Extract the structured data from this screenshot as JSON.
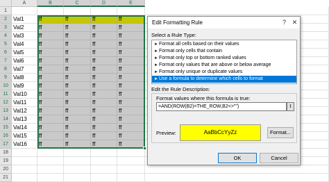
{
  "sheet": {
    "columns": [
      "A",
      "B",
      "C",
      "D",
      "E"
    ],
    "rows": [
      {
        "num": "1",
        "a": "",
        "vals": [
          "",
          "",
          "",
          ""
        ],
        "highlight": false
      },
      {
        "num": "2",
        "a": "Val1",
        "vals": [
          "ff",
          "ff",
          "ff",
          "ff"
        ],
        "highlight": true
      },
      {
        "num": "3",
        "a": "Val2",
        "vals": [
          "ff",
          "ff",
          "ff",
          "ff"
        ],
        "highlight": false
      },
      {
        "num": "4",
        "a": "Val3",
        "vals": [
          "ff",
          "ff",
          "ff",
          "ff"
        ],
        "highlight": false
      },
      {
        "num": "5",
        "a": "Val4",
        "vals": [
          "ff",
          "ff",
          "ff",
          "ff"
        ],
        "highlight": false
      },
      {
        "num": "6",
        "a": "Val5",
        "vals": [
          "ff",
          "ff",
          "ff",
          "ff"
        ],
        "highlight": false
      },
      {
        "num": "7",
        "a": "Val6",
        "vals": [
          "ff",
          "ff",
          "ff",
          "ff"
        ],
        "highlight": false
      },
      {
        "num": "8",
        "a": "Val7",
        "vals": [
          "ff",
          "ff",
          "ff",
          "ff"
        ],
        "highlight": false
      },
      {
        "num": "9",
        "a": "Val8",
        "vals": [
          "ff",
          "ff",
          "ff",
          "ff"
        ],
        "highlight": false
      },
      {
        "num": "10",
        "a": "Val9",
        "vals": [
          "ff",
          "ff",
          "ff",
          "ff"
        ],
        "highlight": false
      },
      {
        "num": "11",
        "a": "Val10",
        "vals": [
          "ff",
          "ff",
          "ff",
          "ff"
        ],
        "highlight": false
      },
      {
        "num": "12",
        "a": "Val11",
        "vals": [
          "ff",
          "ff",
          "ff",
          "ff"
        ],
        "highlight": false
      },
      {
        "num": "13",
        "a": "Val12",
        "vals": [
          "ff",
          "ff",
          "ff",
          "ff"
        ],
        "highlight": false
      },
      {
        "num": "14",
        "a": "Val13",
        "vals": [
          "ff",
          "ff",
          "ff",
          "ff"
        ],
        "highlight": false
      },
      {
        "num": "15",
        "a": "Val14",
        "vals": [
          "ff",
          "ff",
          "ff",
          "ff"
        ],
        "highlight": false
      },
      {
        "num": "16",
        "a": "Val15",
        "vals": [
          "ff",
          "ff",
          "ff",
          "ff"
        ],
        "highlight": false
      },
      {
        "num": "17",
        "a": "Val16",
        "vals": [
          "ff",
          "ff",
          "ff",
          "ff"
        ],
        "highlight": false
      },
      {
        "num": "18",
        "a": "",
        "vals": [
          "",
          "",
          "",
          ""
        ],
        "highlight": false
      },
      {
        "num": "19",
        "a": "",
        "vals": [
          "",
          "",
          "",
          ""
        ],
        "highlight": false
      },
      {
        "num": "20",
        "a": "",
        "vals": [
          "",
          "",
          "",
          ""
        ],
        "highlight": false
      },
      {
        "num": "21",
        "a": "",
        "vals": [
          "",
          "",
          "",
          ""
        ],
        "highlight": false
      }
    ],
    "colors": {
      "highlight": "#c5c800",
      "shaded": "#c9c9c9",
      "selection": "#217346"
    }
  },
  "dialog": {
    "title": "Edit Formatting Rule",
    "help": "?",
    "close": "✕",
    "select_rule_label": "Select a Rule Type:",
    "rule_types": [
      "Format all cells based on their values",
      "Format only cells that contain",
      "Format only top or bottom ranked values",
      "Format only values that are above or below average",
      "Format only unique or duplicate values",
      "Use a formula to determine which cells to format"
    ],
    "selected_rule_index": 5,
    "edit_desc_label": "Edit the Rule Description:",
    "formula_label": "Format values where this formula is true:",
    "formula_value": "=AND(ROW(B2)=THE_ROW,B2<>\"\")",
    "collapse_icon": "⭱",
    "preview_label": "Preview:",
    "preview_text": "AaBbCcYyZz",
    "format_button": "Format...",
    "ok_button": "OK",
    "cancel_button": "Cancel",
    "colors": {
      "preview_fill": "#ffff00",
      "selected_rule": "#0078d7"
    }
  }
}
